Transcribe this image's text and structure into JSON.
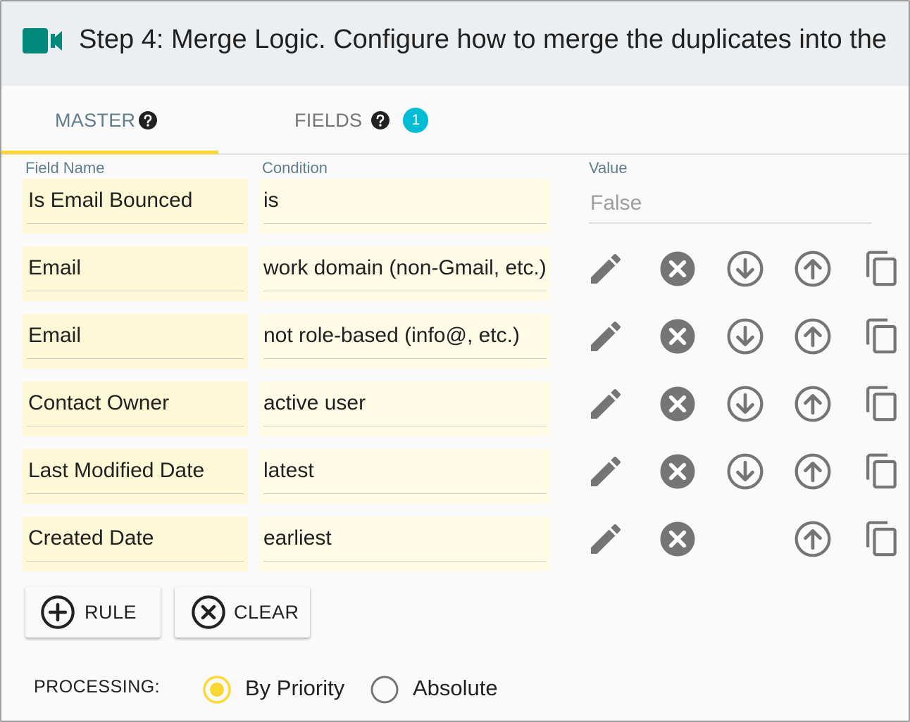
{
  "header": {
    "title": "Step 4: Merge Logic. Configure how to merge the duplicates into the"
  },
  "tabs": {
    "master_label": "MASTER",
    "fields_label": "FIELDS",
    "fields_badge": "1"
  },
  "columns": {
    "field_name": "Field Name",
    "condition": "Condition",
    "value": "Value"
  },
  "rules": [
    {
      "field": "Is Email Bounced",
      "condition": "is",
      "value": "False"
    },
    {
      "field": "Email",
      "condition": "work domain (non-Gmail, etc.)"
    },
    {
      "field": "Email",
      "condition": "not role-based (info@, etc.)"
    },
    {
      "field": "Contact Owner",
      "condition": "active user"
    },
    {
      "field": "Last Modified Date",
      "condition": "latest"
    },
    {
      "field": "Created Date",
      "condition": "earliest"
    }
  ],
  "buttons": {
    "add_rule": "RULE",
    "clear": "CLEAR"
  },
  "processing": {
    "label": "PROCESSING:",
    "options": [
      "By Priority",
      "Absolute"
    ],
    "selected": "By Priority"
  },
  "colors": {
    "accent_yellow": "#fdd835",
    "teal_icon": "#00897b",
    "badge": "#00bcd4",
    "icon_gray": "#757575"
  }
}
